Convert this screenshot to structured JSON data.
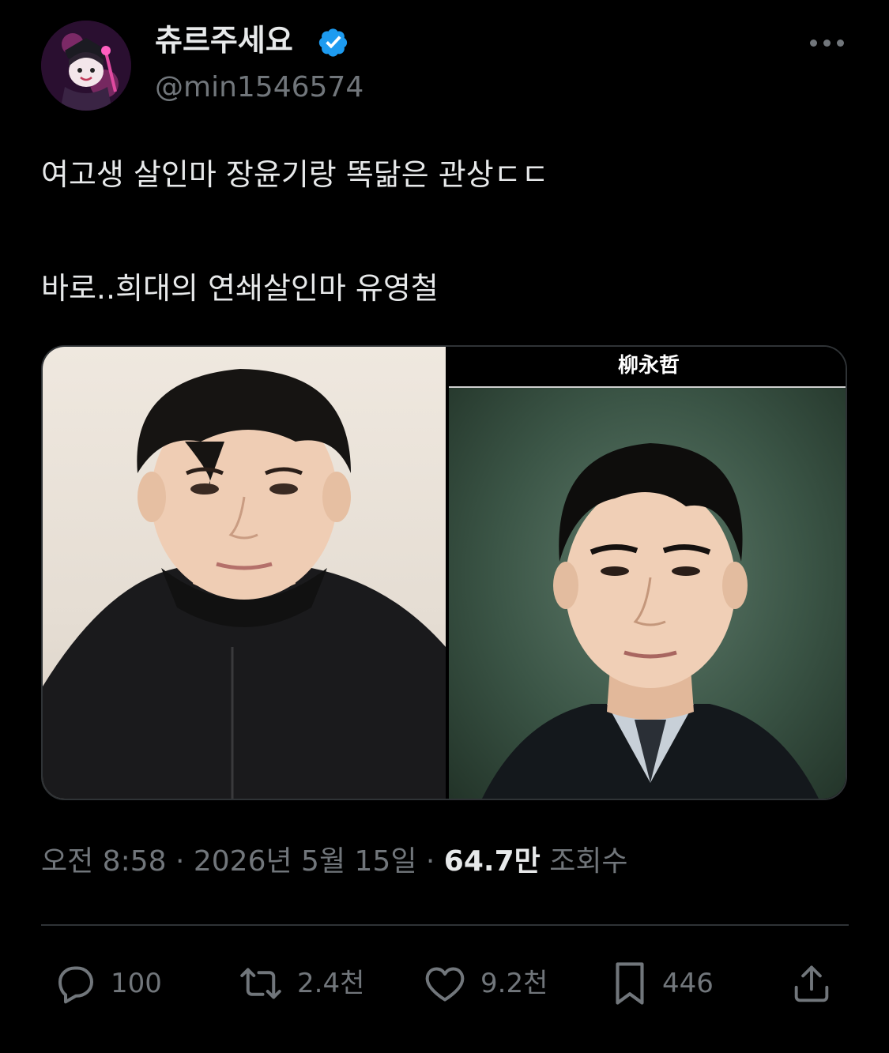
{
  "user": {
    "display_name": "츄르주세요",
    "handle": "@min1546574"
  },
  "tweet": {
    "line1": "여고생 살인마 장윤기랑 똑닮은 관상ㄷㄷ",
    "line2": "바로..희대의 연쇄살인마 유영철"
  },
  "media": {
    "right_caption": "柳永哲"
  },
  "meta": {
    "time": "오전 8:58",
    "sep1": " · ",
    "date": "2026년 5월 15일",
    "sep2": " · ",
    "views_count": "64.7만",
    "views_label": " 조회수"
  },
  "actions": {
    "replies": "100",
    "retweets": "2.4천",
    "likes": "9.2천",
    "bookmarks": "446"
  },
  "colors": {
    "background": "#000000",
    "primary_text": "#e7e9ea",
    "secondary_text": "#71767b",
    "verified": "#1d9bf0",
    "divider": "#2f3336"
  },
  "icons": [
    "more-icon",
    "verified-badge-icon",
    "reply-icon",
    "retweet-icon",
    "like-icon",
    "bookmark-icon",
    "share-icon"
  ]
}
